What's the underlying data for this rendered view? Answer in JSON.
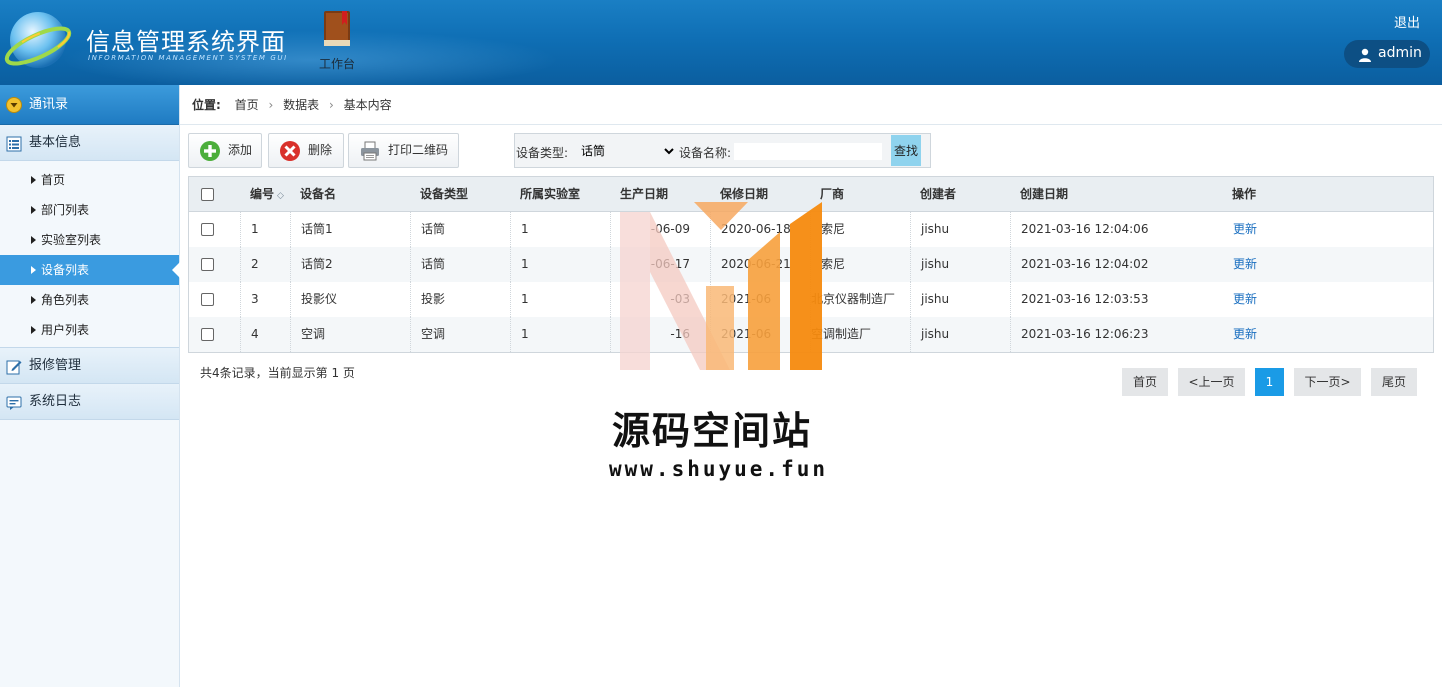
{
  "header": {
    "app_title": "信息管理系统界面",
    "app_subtitle": "INFORMATION MANAGEMENT SYSTEM GUI",
    "workbench_label": "工作台",
    "logout_label": "退出",
    "user_name": "admin",
    "icons": [
      "globe-logo-icon",
      "book-icon",
      "user-icon"
    ]
  },
  "sidebar": {
    "groups": [
      {
        "label": "通讯录",
        "icon": "down-circle-icon"
      },
      {
        "label": "基本信息",
        "icon": "list-icon"
      },
      {
        "label": "报修管理",
        "icon": "edit-icon"
      },
      {
        "label": "系统日志",
        "icon": "message-icon"
      }
    ],
    "items": [
      {
        "label": "首页"
      },
      {
        "label": "部门列表"
      },
      {
        "label": "实验室列表"
      },
      {
        "label": "设备列表",
        "active": true
      },
      {
        "label": "角色列表"
      },
      {
        "label": "用户列表"
      }
    ]
  },
  "breadcrumb": {
    "label": "位置:",
    "items": [
      "首页",
      "数据表",
      "基本内容"
    ]
  },
  "toolbar": {
    "add_label": "添加",
    "delete_label": "删除",
    "print_label": "打印二维码"
  },
  "filter": {
    "type_label": "设备类型:",
    "type_value": "话筒",
    "name_label": "设备名称:",
    "name_value": "",
    "search_label": "查找"
  },
  "table": {
    "columns": [
      "编号",
      "设备名",
      "设备类型",
      "所属实验室",
      "生产日期",
      "保修日期",
      "厂商",
      "创建者",
      "创建日期",
      "操作"
    ],
    "sort_icon": "◇",
    "rows": [
      [
        "1",
        "话筒1",
        "话筒",
        "1",
        "-06-09",
        "2020-06-18",
        "索尼",
        "jishu",
        "2021-03-16 12:04:06",
        "更新"
      ],
      [
        "2",
        "话筒2",
        "话筒",
        "1",
        "-06-17",
        "2020-06-21",
        "索尼",
        "jishu",
        "2021-03-16 12:04:02",
        "更新"
      ],
      [
        "3",
        "投影仪",
        "投影",
        "1",
        "-03",
        "2021-06",
        "北京仪器制造厂",
        "jishu",
        "2021-03-16 12:03:53",
        "更新"
      ],
      [
        "4",
        "空调",
        "空调",
        "1",
        "-16",
        "2021-06",
        "空调制造厂",
        "jishu",
        "2021-03-16 12:06:23",
        "更新"
      ]
    ]
  },
  "pager": {
    "record_info": "共4条记录，当前显示第 1 页",
    "first_label": "首页",
    "prev_label": "<上一页",
    "current_page": "1",
    "next_label": "下一页>",
    "last_label": "尾页"
  },
  "watermark": {
    "title": "源码空间站",
    "url": "www.shuyue.fun"
  },
  "colors": {
    "header_blue": "#0f6fb5",
    "active_blue": "#3a9be0",
    "link_blue": "#1a6fc0",
    "pager_current": "#1a9be6",
    "search_button": "#8fd3ee",
    "watermark_orange": "#f7901e"
  }
}
